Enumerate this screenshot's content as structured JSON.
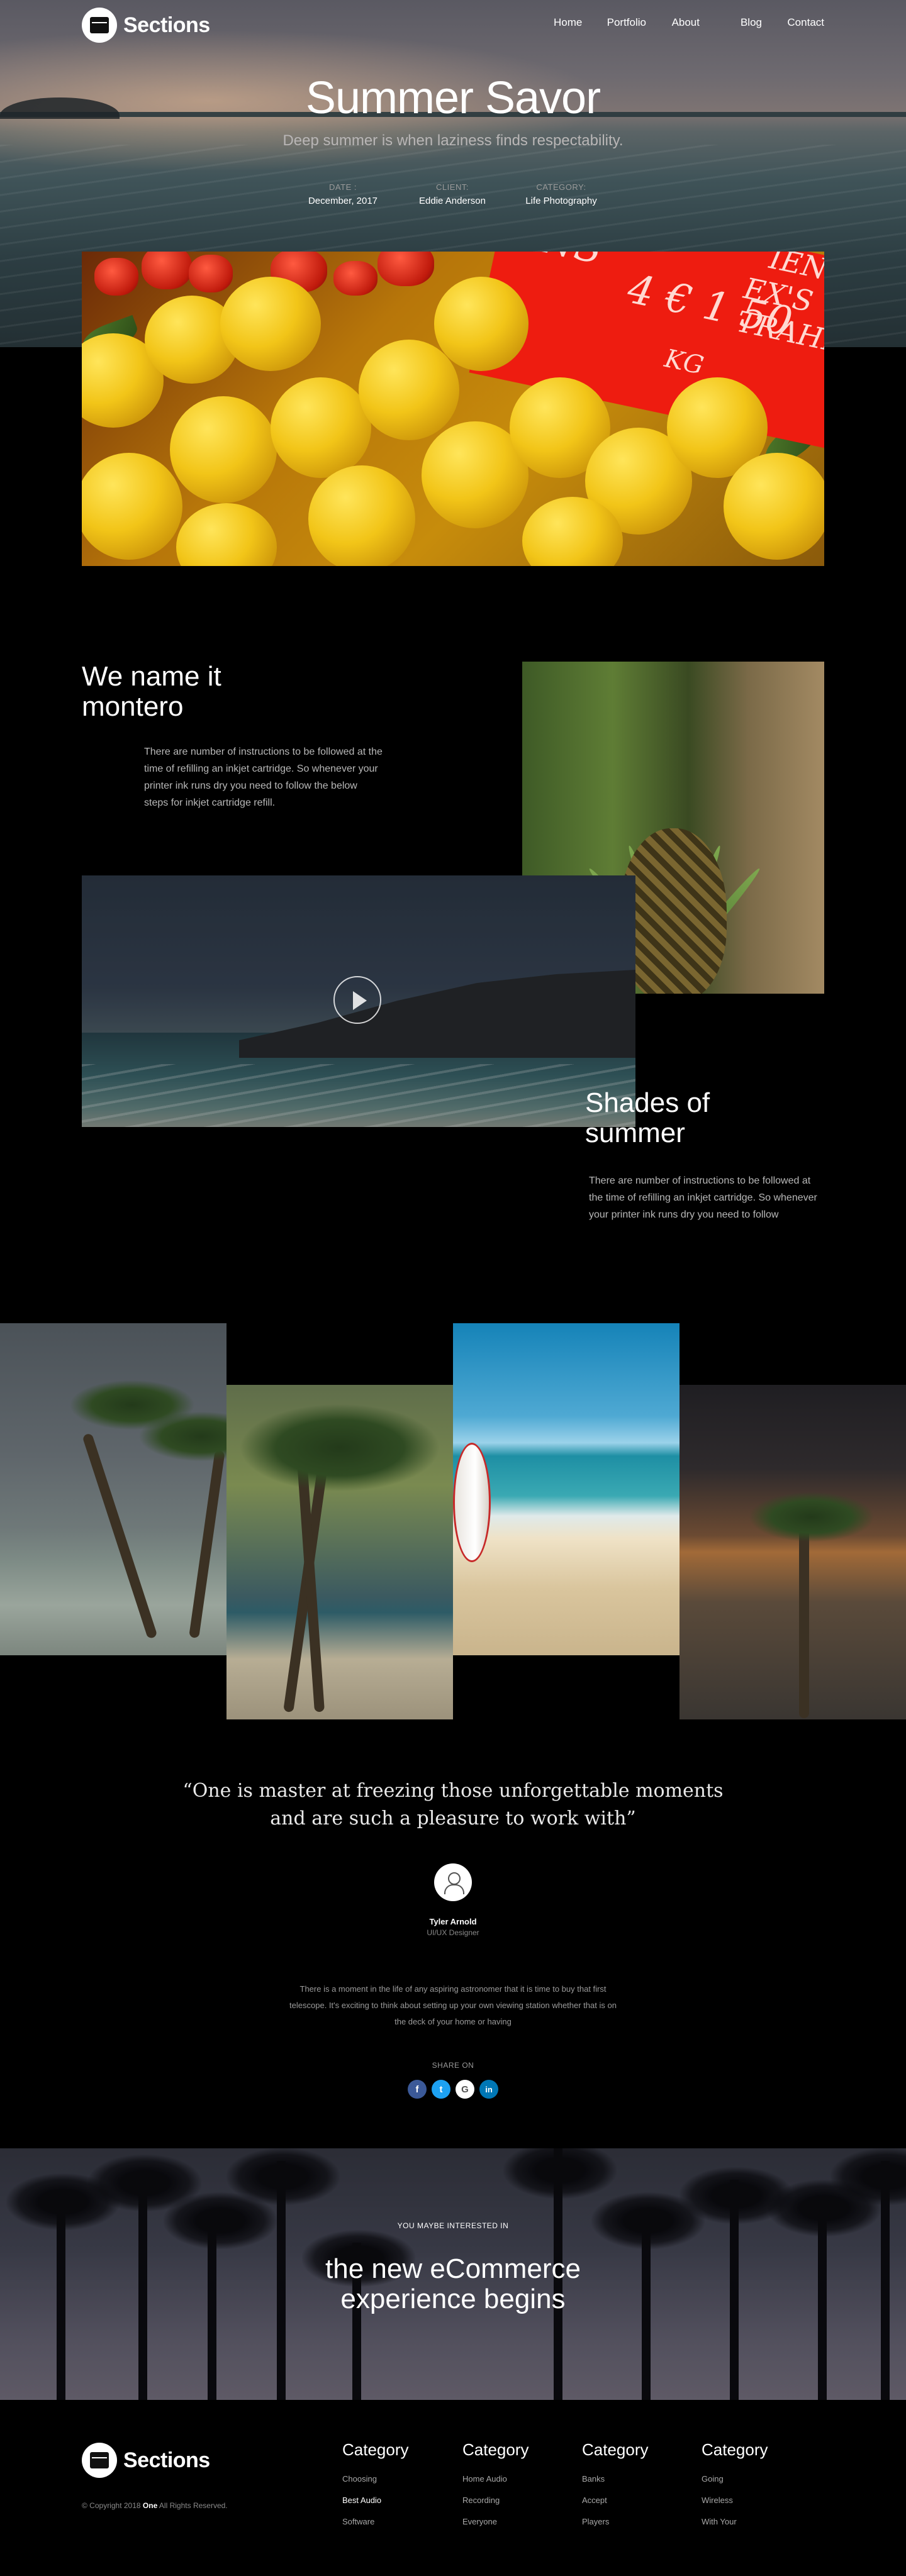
{
  "brand": {
    "name": "Sections"
  },
  "nav": {
    "items": [
      "Home",
      "Portfolio",
      "About",
      "Blog",
      "Contact"
    ]
  },
  "hero": {
    "title": "Summer Savor",
    "subtitle": "Deep summer is when laziness finds respectability.",
    "meta": [
      {
        "key": "DATE :",
        "value": "December, 2017"
      },
      {
        "key": "CLIENT:",
        "value": "Eddie Anderson"
      },
      {
        "key": "CATEGORY:",
        "value": "Life Photography"
      }
    ]
  },
  "lemons_sign": [
    "ENS",
    "4 € 1 50",
    "KG",
    "IEN",
    "EX'S TRAHE"
  ],
  "section1": {
    "title_line1": "We name it",
    "title_line2": "montero",
    "body": "There are number of instructions to be followed at the time of refilling an inkjet cartridge. So whenever your printer ink runs dry you need to follow the below steps for inkjet cartridge refill."
  },
  "section2": {
    "title_line1": "Shades of",
    "title_line2": "summer",
    "body": "There are number of instructions to be followed at the time of refilling an inkjet cartridge. So whenever your printer ink runs dry you need to follow"
  },
  "testimonial": {
    "quote_line1": "“One is master at freezing those unforgettable moments",
    "quote_line2": "and are such a pleasure to work with”",
    "name": "Tyler Arnold",
    "role": "UI/UX Designer",
    "body_line1": "There is a moment in the life of any aspiring astronomer that it is time to buy that first",
    "body_line2": "telescope. It's exciting to think about setting up your own viewing station whether that is on",
    "body_line3": "the deck of your home or having"
  },
  "share": {
    "label": "SHARE ON",
    "icons": [
      {
        "name": "facebook-icon",
        "glyph": "f",
        "color": "#3b5998"
      },
      {
        "name": "twitter-icon",
        "glyph": "t",
        "color": "#1da1f2"
      },
      {
        "name": "google-icon",
        "glyph": "G",
        "color": "#ffffff"
      },
      {
        "name": "linkedin-icon",
        "glyph": "in",
        "color": "#0077b5"
      }
    ]
  },
  "banner": {
    "eyebrow": "YOU MAYBE INTERESTED IN",
    "title_line1": "the new eCommerce",
    "title_line2": "experience begins"
  },
  "footer": {
    "copyright_prefix": "© Copyright 2018",
    "copyright_brand": "One",
    "copyright_suffix": "All Rights Reserved.",
    "columns": [
      {
        "title": "Category",
        "links": [
          "Choosing",
          "Best Audio",
          "Software"
        ],
        "active": 1
      },
      {
        "title": "Category",
        "links": [
          "Home Audio",
          "Recording",
          "Everyone"
        ],
        "active": -1
      },
      {
        "title": "Category",
        "links": [
          "Banks",
          "Accept",
          "Players"
        ],
        "active": -1
      },
      {
        "title": "Category",
        "links": [
          "Going",
          "Wireless",
          "With Your"
        ],
        "active": -1
      }
    ]
  }
}
